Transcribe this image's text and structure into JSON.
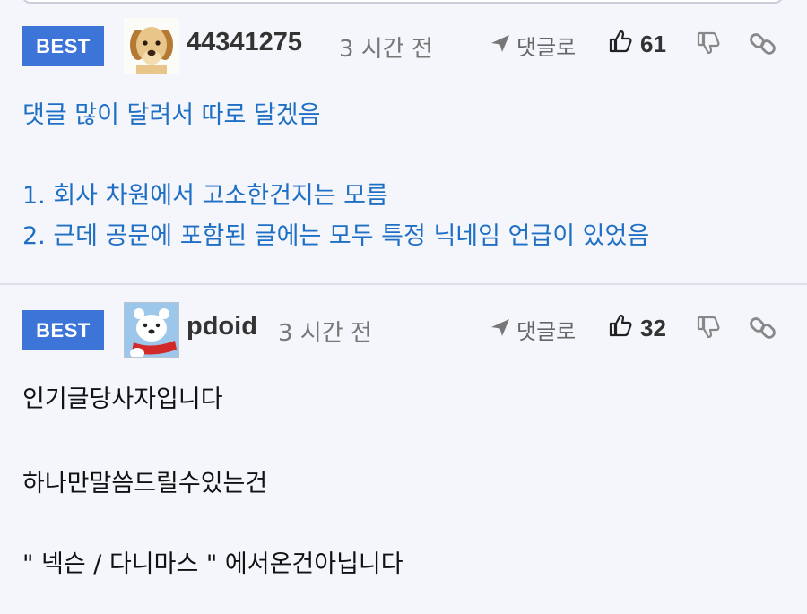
{
  "comments": [
    {
      "badge": "BEST",
      "username": "44341275",
      "time": "3 시간 전",
      "reply_label": "댓글로",
      "likes": "61",
      "lines": [
        "댓글 많이 달려서 따로 달겠음",
        "",
        "1. 회사 차원에서 고소한건지는 모름",
        "2. 근데 공문에 포함된 글에는 모두 특정 닉네임 언급이 있었음"
      ]
    },
    {
      "badge": "BEST",
      "username": "pdoid",
      "time": "3 시간 전",
      "reply_label": "댓글로",
      "likes": "32",
      "lines": [
        "인기글당사자입니다",
        "",
        "하나만말씀드릴수있는건",
        "",
        "\" 넥슨 / 다니마스 \" 에서온건아닙니다"
      ]
    }
  ],
  "colors": {
    "badge": "#3c74d8",
    "highlight_text": "#1f6fc4",
    "background": "#f4f6fb"
  },
  "icons": {
    "reply": "send-arrow-icon",
    "like": "thumbs-up-icon",
    "dislike": "thumbs-down-icon",
    "link": "link-icon"
  }
}
